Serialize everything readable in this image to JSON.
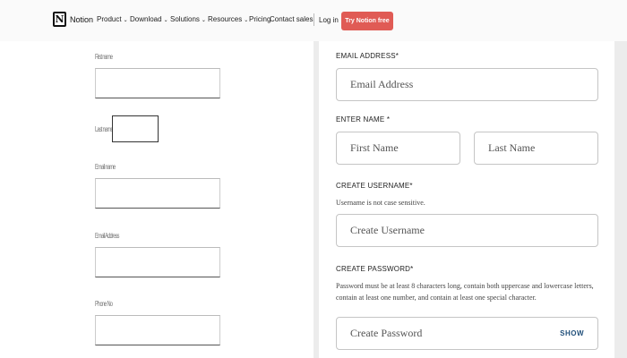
{
  "nav": {
    "logo_glyph": "N",
    "brand": "Notion",
    "items": [
      {
        "label": "Product",
        "chevron": "⌄"
      },
      {
        "label": "Download",
        "chevron": "⌄"
      },
      {
        "label": "Solutions",
        "chevron": "⌄"
      },
      {
        "label": "Resources",
        "chevron": "⌄"
      },
      {
        "label": "Pricing"
      },
      {
        "label": "Contact sales"
      }
    ],
    "login": "Log in",
    "cta": "Try Notion free",
    "cta_color": "#e05b55"
  },
  "left_form": {
    "fields": [
      {
        "label": "First name"
      },
      {
        "label": "Last name"
      },
      {
        "label": "Email name"
      },
      {
        "label": "Email Address"
      },
      {
        "label": "Phone No"
      }
    ]
  },
  "right_form": {
    "email": {
      "label": "EMAIL ADDRESS*",
      "placeholder": "Email Address"
    },
    "name": {
      "label": "ENTER NAME *",
      "first_placeholder": "First Name",
      "last_placeholder": "Last Name"
    },
    "username": {
      "label": "CREATE USERNAME*",
      "help": "Username is not case sensitive.",
      "placeholder": "Create Username"
    },
    "password": {
      "label": "CREATE PASSWORD*",
      "help": "Password must be at least 8 characters long, contain both uppercase and lowercase letters, contain at least one number, and contain at least one special character.",
      "placeholder": "Create Password",
      "show_label": "SHOW"
    }
  }
}
